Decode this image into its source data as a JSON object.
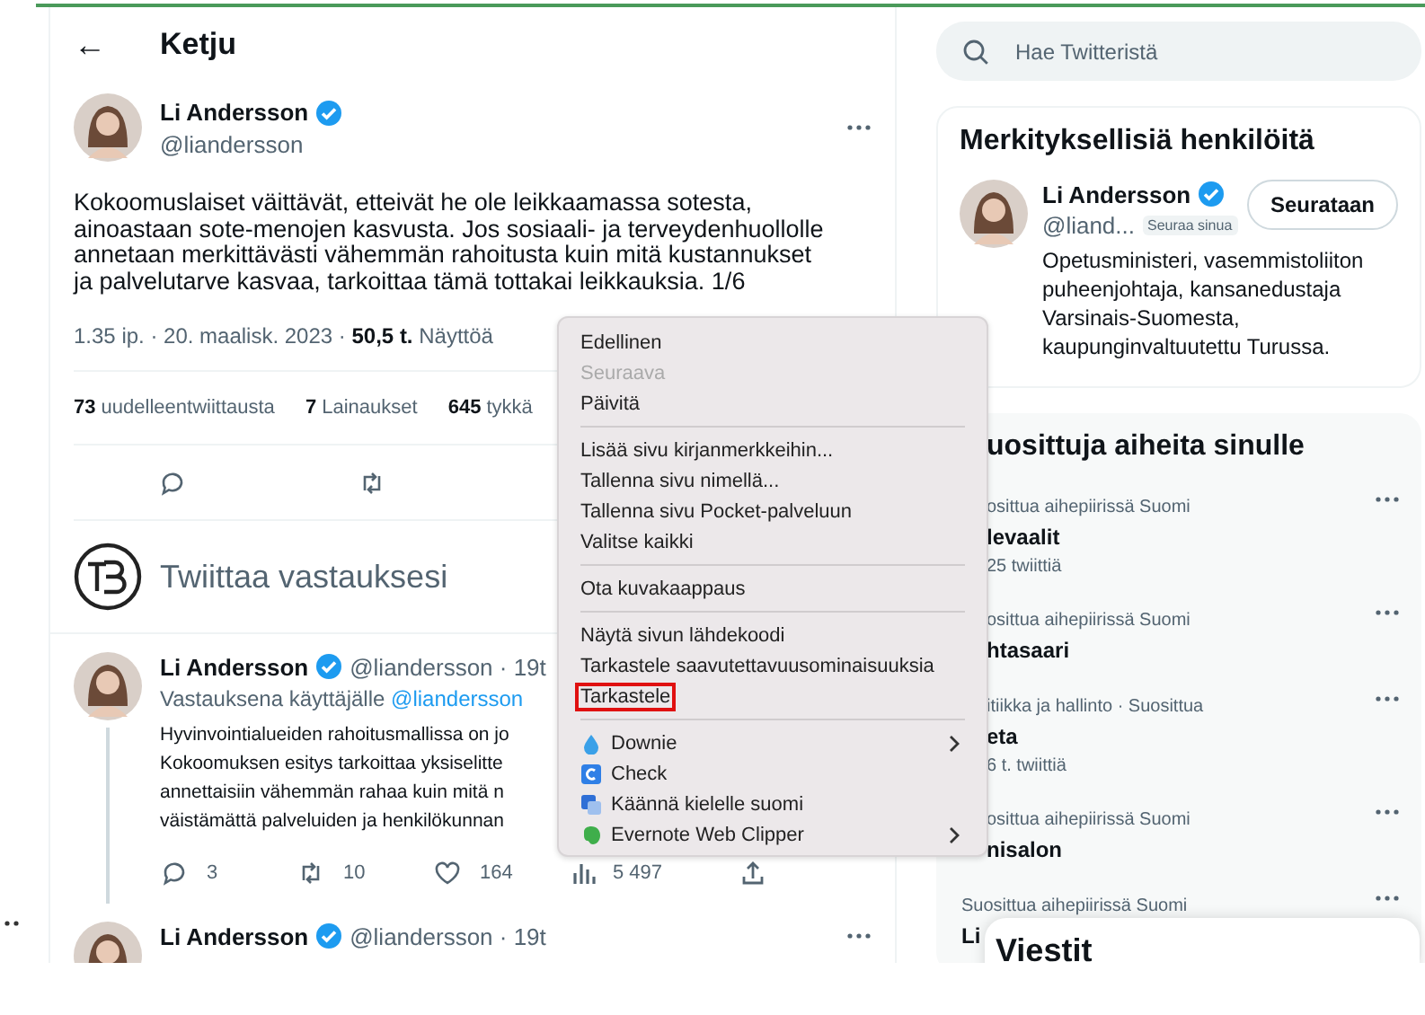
{
  "header": {
    "back": "←",
    "title": "Ketju"
  },
  "tweet": {
    "author": {
      "name": "Li Andersson",
      "verified": true,
      "handle": "@liandersson"
    },
    "text": "Kokoomuslaiset väittävät, etteivät he ole leikkaamassa sotesta, ainoastaan sote-menojen kasvusta. Jos sosiaali- ja terveydenhuollolle annetaan merkittävästi vähemmän rahoitusta kuin mitä kustannukset ja palvelutarve kasvaa, tarkoittaa tämä tottakai leikkauksia. 1/6",
    "meta": "1.35 ip. · 20. maalisk. 2023 · **50,5 t.** Näyttöä",
    "stats": [
      "**73** uudelleentwiittausta",
      "**7** Lainaukset",
      "**645** tykkä"
    ],
    "actions": [
      {
        "kind": "reply"
      },
      {
        "kind": "retweet"
      }
    ]
  },
  "compose": {
    "placeholder": "Twiittaa vastauksesi"
  },
  "replies": [
    {
      "author": {
        "name": "Li Andersson",
        "verified": true
      },
      "meta": "@liandersson · 19t",
      "reply_to_label": "Vastauksena käyttäjälle",
      "reply_to": "@liandersson",
      "text_lines": [
        "Hyvinvointialueiden rahoitusmallissa on jo",
        "Kokoomuksen esitys tarkoittaa yksiselitte",
        "annettaisiin vähemmän rahaa kuin mitä n",
        "väistämättä palveluiden ja henkilökunnan"
      ],
      "actions": [
        {
          "kind": "reply",
          "count": "3"
        },
        {
          "kind": "retweet",
          "count": "10"
        },
        {
          "kind": "like",
          "count": "164"
        },
        {
          "kind": "views",
          "count": "5 497"
        },
        {
          "kind": "share"
        }
      ]
    },
    {
      "author": {
        "name": "Li Andersson",
        "verified": true
      },
      "meta": "@liandersson · 19t"
    }
  ],
  "search": {
    "placeholder": "Hae Twitteristä"
  },
  "who_to_follow": {
    "title": "Merkityksellisiä henkilöitä",
    "people": [
      {
        "name": "Li Andersson",
        "verified": true,
        "handle": "@liand...",
        "follows_you": "Seuraa sinua",
        "button": "Seurataan",
        "bio": "Opetusministeri, vasemmistoliiton puheenjohtaja, kansanedustaja Varsinais-Suomesta, kaupunginvaltuutettu Turussa."
      }
    ]
  },
  "trends": {
    "title": "uosittuja aiheita sinulle",
    "items": [
      {
        "context": "osittua aihepiirissä Suomi",
        "name": "levaalit",
        "count": "25 twiittiä"
      },
      {
        "context": "osittua aihepiirissä Suomi",
        "name": "htasaari"
      },
      {
        "context": "itiikka ja hallinto · Suosittua",
        "name": "eta",
        "count": "6 t. twiittiä"
      },
      {
        "context": "osittua aihepiirissä Suomi",
        "name": "nisalon"
      },
      {
        "context": "Suosittua aihepiirissä Suomi",
        "name": "Li"
      }
    ]
  },
  "messages": {
    "title": "Viestit"
  },
  "context_menu": {
    "groups": [
      [
        {
          "label": "Edellinen",
          "disabled": false,
          "submenu": false,
          "marked": false
        },
        {
          "label": "Seuraava",
          "disabled": true,
          "submenu": false,
          "marked": false
        },
        {
          "label": "Päivitä",
          "disabled": false,
          "submenu": false,
          "marked": false
        }
      ],
      [
        {
          "label": "Lisää sivu kirjanmerkkeihin...",
          "disabled": false,
          "submenu": false,
          "marked": false
        },
        {
          "label": "Tallenna sivu nimellä...",
          "disabled": false,
          "submenu": false,
          "marked": false
        },
        {
          "label": "Tallenna sivu Pocket-palveluun",
          "disabled": false,
          "submenu": false,
          "marked": false
        },
        {
          "label": "Valitse kaikki",
          "disabled": false,
          "submenu": false,
          "marked": false
        }
      ],
      [
        {
          "label": "Ota kuvakaappaus",
          "disabled": false,
          "submenu": false,
          "marked": false
        }
      ],
      [
        {
          "label": "Näytä sivun lähdekoodi",
          "disabled": false,
          "submenu": false,
          "marked": false
        },
        {
          "label": "Tarkastele saavutettavuusominaisuuksia",
          "disabled": false,
          "submenu": false,
          "marked": false
        },
        {
          "label": "Tarkastele",
          "disabled": false,
          "submenu": false,
          "marked": true
        }
      ],
      [
        {
          "label": "Downie",
          "kind": "extension",
          "disabled": false,
          "submenu": true,
          "marked": false
        },
        {
          "label": "Check",
          "kind": "extension",
          "disabled": false,
          "submenu": false,
          "marked": false
        },
        {
          "label": "Käännä kielelle suomi",
          "kind": "extension",
          "disabled": false,
          "submenu": false,
          "marked": false
        },
        {
          "label": "Evernote Web Clipper",
          "kind": "extension",
          "disabled": false,
          "submenu": true,
          "marked": false
        }
      ]
    ]
  }
}
